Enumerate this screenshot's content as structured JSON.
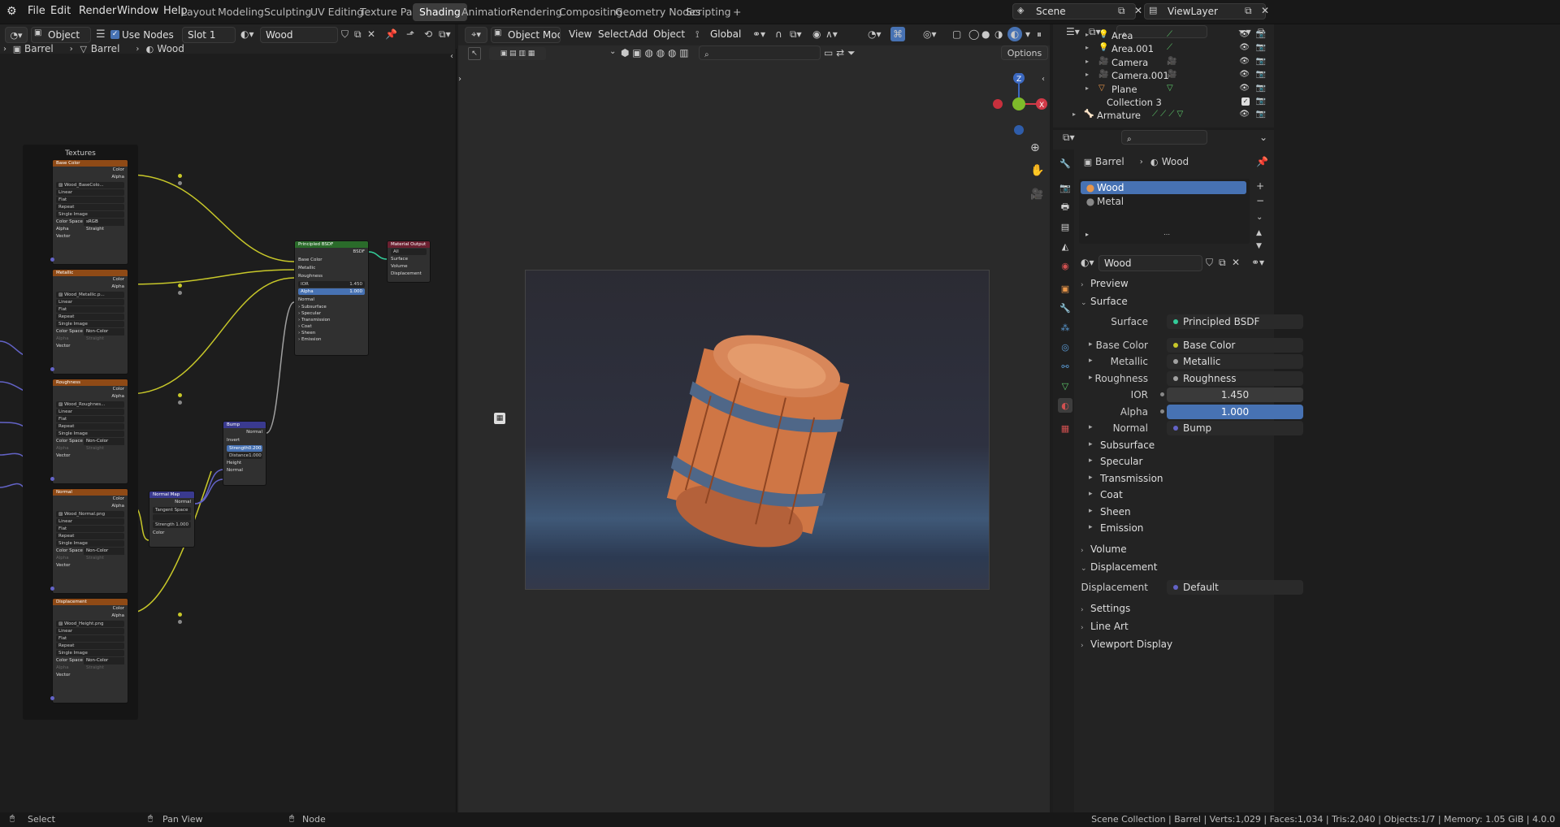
{
  "topbar": {
    "menus": [
      "File",
      "Edit",
      "Render",
      "Window",
      "Help"
    ],
    "workspaces": [
      "Layout",
      "Modeling",
      "Sculpting",
      "UV Editing",
      "Texture Paint",
      "Shading",
      "Animation",
      "Rendering",
      "Compositing",
      "Geometry Nodes",
      "Scripting"
    ],
    "active_workspace": "Shading",
    "add_tab": "+",
    "scene": "Scene",
    "view_layer": "ViewLayer"
  },
  "node_header": {
    "object_mode": "Object",
    "use_nodes": "Use Nodes",
    "slot": "Slot 1",
    "material": "Wood"
  },
  "breadcrumb": {
    "object": "Barrel",
    "mesh": "Barrel",
    "material": "Wood"
  },
  "frame_label": "Textures",
  "texture_nodes": [
    {
      "title": "Base Color",
      "image": "Wood_BaseColo...",
      "interp": "Linear",
      "proj": "Flat",
      "ext": "Repeat",
      "src": "Single Image",
      "cs_label": "Color Space",
      "cs": "sRGB",
      "alpha_label": "Alpha",
      "alpha": "Straight",
      "out_color": "Color",
      "out_alpha": "Alpha",
      "in_vector": "Vector"
    },
    {
      "title": "Metallic",
      "image": "Wood_Metallic.p...",
      "interp": "Linear",
      "proj": "Flat",
      "ext": "Repeat",
      "src": "Single Image",
      "cs_label": "Color Space",
      "cs": "Non-Color",
      "alpha_label": "Alpha",
      "alpha": "Straight",
      "out_color": "Color",
      "out_alpha": "Alpha",
      "in_vector": "Vector"
    },
    {
      "title": "Roughness",
      "image": "Wood_Roughnes...",
      "interp": "Linear",
      "proj": "Flat",
      "ext": "Repeat",
      "src": "Single Image",
      "cs_label": "Color Space",
      "cs": "Non-Color",
      "alpha_label": "Alpha",
      "alpha": "Straight",
      "out_color": "Color",
      "out_alpha": "Alpha",
      "in_vector": "Vector"
    },
    {
      "title": "Normal",
      "image": "Wood_Normal.png",
      "interp": "Linear",
      "proj": "Flat",
      "ext": "Repeat",
      "src": "Single Image",
      "cs_label": "Color Space",
      "cs": "Non-Color",
      "alpha_label": "Alpha",
      "alpha": "Straight",
      "out_color": "Color",
      "out_alpha": "Alpha",
      "in_vector": "Vector"
    },
    {
      "title": "Displacement",
      "image": "Wood_Height.png",
      "interp": "Linear",
      "proj": "Flat",
      "ext": "Repeat",
      "src": "Single Image",
      "cs_label": "Color Space",
      "cs": "Non-Color",
      "alpha_label": "Alpha",
      "alpha": "Straight",
      "out_color": "Color",
      "out_alpha": "Alpha",
      "in_vector": "Vector"
    }
  ],
  "bsdf_node": {
    "title": "Principled BSDF",
    "out": "BSDF",
    "inputs": [
      "Base Color",
      "Metallic",
      "Roughness"
    ],
    "ior_label": "IOR",
    "ior": "1.450",
    "alpha_label": "Alpha",
    "alpha": "1.000",
    "normal": "Normal",
    "subs": [
      "Subsurface",
      "Specular",
      "Transmission",
      "Coat",
      "Sheen",
      "Emission"
    ]
  },
  "output_node": {
    "title": "Material Output",
    "target": "All",
    "inputs": [
      "Surface",
      "Volume",
      "Displacement"
    ]
  },
  "bump_node": {
    "title": "Bump",
    "out": "Normal",
    "invert": "Invert",
    "strength_label": "Strength",
    "strength": "0.200",
    "distance_label": "Distance",
    "distance": "1.000",
    "inputs": [
      "Height",
      "Normal"
    ]
  },
  "normalmap_node": {
    "title": "Normal Map",
    "out": "Normal",
    "space": "Tangent Space",
    "uv": "",
    "strength_label": "Strength",
    "strength": "1.000",
    "in": "Color"
  },
  "viewport": {
    "mode": "Object Mode",
    "menus": [
      "View",
      "Select",
      "Add",
      "Object"
    ],
    "orientation": "Global",
    "options": "Options"
  },
  "outliner": {
    "rows": [
      "Area",
      "Area.001",
      "Camera",
      "Camera.001",
      "Plane",
      "Collection 3",
      "Armature"
    ]
  },
  "properties": {
    "object": "Barrel",
    "material": "Wood",
    "slots": [
      "Wood",
      "Metal"
    ],
    "material_field": "Wood",
    "sections": {
      "preview": "Preview",
      "surface": "Surface",
      "volume": "Volume",
      "displacement": "Displacement",
      "settings": "Settings",
      "lineart": "Line Art",
      "viewport_display": "Viewport Display"
    },
    "surface_label": "Surface",
    "surface_val": "Principled BSDF",
    "inputs": [
      {
        "label": "Base Color",
        "val": "Base Color",
        "color": "#c7c729"
      },
      {
        "label": "Metallic",
        "val": "Metallic",
        "color": "#a1a1a1"
      },
      {
        "label": "Roughness",
        "val": "Roughness",
        "color": "#a1a1a1"
      }
    ],
    "ior_label": "IOR",
    "ior": "1.450",
    "alpha_label": "Alpha",
    "alpha": "1.000",
    "normal_label": "Normal",
    "normal_val": "Bump",
    "subs": [
      "Subsurface",
      "Specular",
      "Transmission",
      "Coat",
      "Sheen",
      "Emission"
    ],
    "disp_label": "Displacement",
    "disp_val": "Default"
  },
  "status": {
    "left": "Select",
    "mid": "Pan View",
    "right": "Node",
    "info": "Scene Collection | Barrel | Verts:1,029 | Faces:1,034 | Tris:2,040 | Objects:1/7 | Memory: 1.05 GiB | 4.0.0"
  },
  "colors": {
    "texture_header": "#8f4a16",
    "bsdf_header": "#2a6b2a",
    "output_header": "#6b2030",
    "vector_header": "#3a3a8f",
    "color_link": "#c7c729",
    "grey_link": "#a0a0a0",
    "vector_link": "#6363c7",
    "accent": "#4772b3"
  }
}
